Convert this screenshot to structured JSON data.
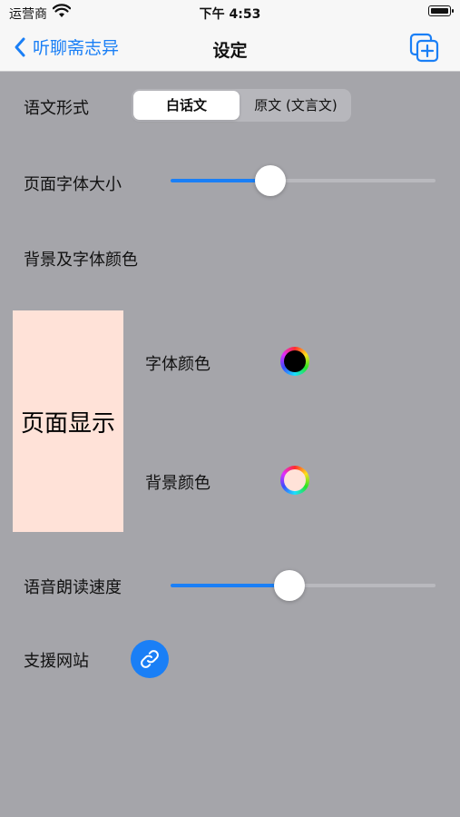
{
  "status_bar": {
    "carrier": "运营商",
    "time": "下午 4:53"
  },
  "nav": {
    "back_label": "听聊斋志异",
    "title": "设定"
  },
  "settings": {
    "text_form": {
      "label": "语文形式",
      "options": [
        "白话文",
        "原文 (文言文)"
      ],
      "selected": 0
    },
    "font_size": {
      "label": "页面字体大小",
      "value": 0.36
    },
    "colors_section": {
      "label": "背景及字体颜色"
    },
    "preview": {
      "text": "页面显示"
    },
    "font_color": {
      "label": "字体颜色",
      "color": "#000000"
    },
    "bg_color": {
      "label": "背景颜色",
      "color": "#ffe2d8"
    },
    "speech_rate": {
      "label": "语音朗读速度",
      "value": 0.44
    },
    "support_site": {
      "label": "支援网站"
    }
  },
  "colors": {
    "accent": "#1a7ff6",
    "background": "#a5a5aa"
  }
}
